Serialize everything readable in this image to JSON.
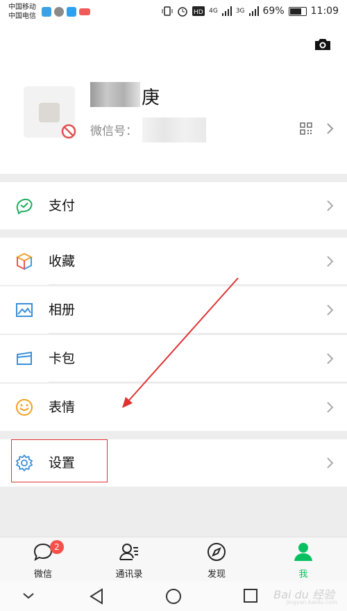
{
  "status_bar": {
    "carrier_1": "中国移动",
    "carrier_2": "中国电信",
    "signal_1": "4G",
    "signal_2": "3G",
    "battery": "69%",
    "time": "11:09",
    "battery_level": 0.69
  },
  "profile": {
    "nickname_visible": "庚",
    "wechat_id_label": "微信号："
  },
  "menu": {
    "pay": "支付",
    "favorites": "收藏",
    "album": "相册",
    "cards": "卡包",
    "stickers": "表情",
    "settings": "设置"
  },
  "tabs": {
    "chats": "微信",
    "chats_badge": "2",
    "contacts": "通讯录",
    "discover": "发现",
    "me": "我"
  },
  "watermark": {
    "text": "Bai du 经验",
    "sub": "jingyan.baidu.com"
  },
  "colors": {
    "accent_green": "#07c160",
    "annotation_red": "#e03030",
    "badge_red": "#f5504a"
  }
}
